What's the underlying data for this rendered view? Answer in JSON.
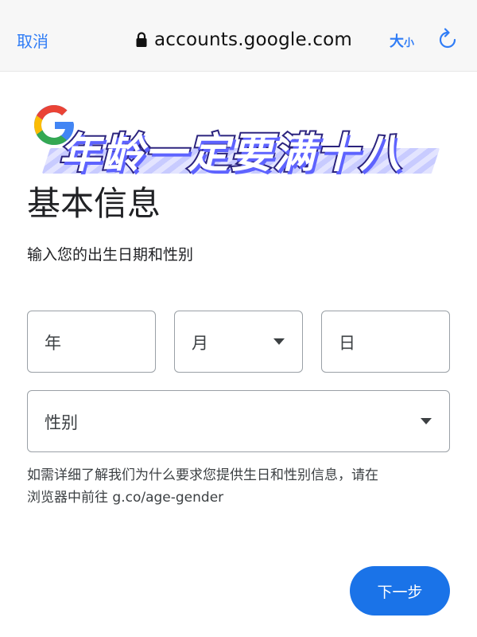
{
  "browser": {
    "cancel_label": "取消",
    "url": "accounts.google.com",
    "text_size_big": "大",
    "text_size_small": "小"
  },
  "banner": {
    "text": "年龄一定要满十八"
  },
  "form": {
    "title": "基本信息",
    "subtitle": "输入您的出生日期和性别",
    "year_placeholder": "年",
    "month_placeholder": "月",
    "day_placeholder": "日",
    "gender_placeholder": "性别",
    "note_line1": "如需详细了解我们为什么要求您提供生日和性别信息，请在",
    "note_line2": "浏览器中前往 g.co/age-gender",
    "next_label": "下一步"
  },
  "colors": {
    "accent": "#1a73e8",
    "browser_link": "#2f7cf6",
    "banner_stroke": "#2b237d"
  }
}
